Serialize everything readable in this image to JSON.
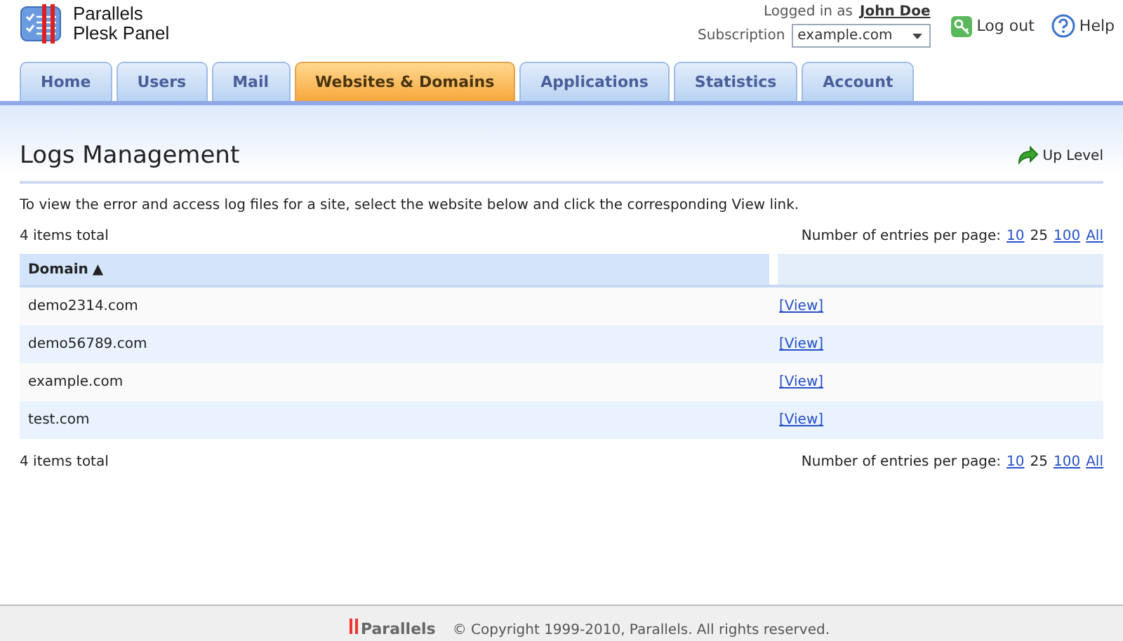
{
  "logo": {
    "line1": "Parallels",
    "line2": "Plesk Panel"
  },
  "user": {
    "label": "Logged in as",
    "name": "John Doe"
  },
  "subscription": {
    "label": "Subscription",
    "value": "example.com"
  },
  "header_links": [
    {
      "kind": "logout",
      "label": "Log out"
    },
    {
      "kind": "help",
      "label": "Help"
    }
  ],
  "tabs": [
    {
      "label": "Home",
      "selected": false
    },
    {
      "label": "Users",
      "selected": false
    },
    {
      "label": "Mail",
      "selected": false
    },
    {
      "label": "Websites & Domains",
      "selected": true
    },
    {
      "label": "Applications",
      "selected": false
    },
    {
      "label": "Statistics",
      "selected": false
    },
    {
      "label": "Account",
      "selected": false
    }
  ],
  "page": {
    "title": "Logs Management",
    "up_level": "Up Level",
    "description": "To view the error and access log files for a site, select the website below and click the corresponding View link."
  },
  "pager_top": {
    "total": "4 items total",
    "label": "Number of entries per page:",
    "options": [
      {
        "label": "10",
        "selected": false
      },
      {
        "label": "25",
        "selected": true
      },
      {
        "label": "100",
        "selected": false
      },
      {
        "label": "All",
        "selected": false
      }
    ]
  },
  "table": {
    "columns": [
      {
        "label": "Domain",
        "sort": "▲"
      }
    ],
    "rows": [
      {
        "domain": "demo2314.com",
        "action": "[View]"
      },
      {
        "domain": "demo56789.com",
        "action": "[View]"
      },
      {
        "domain": "example.com",
        "action": "[View]"
      },
      {
        "domain": "test.com",
        "action": "[View]"
      }
    ]
  },
  "pager_bottom": {
    "total": "4 items total",
    "label": "Number of entries per page:",
    "options": [
      {
        "label": "10",
        "selected": false
      },
      {
        "label": "25",
        "selected": true
      },
      {
        "label": "100",
        "selected": false
      },
      {
        "label": "All",
        "selected": false
      }
    ]
  },
  "footer": {
    "brand": "Parallels",
    "copyright": "© Copyright 1999-2010, Parallels. All rights reserved."
  }
}
